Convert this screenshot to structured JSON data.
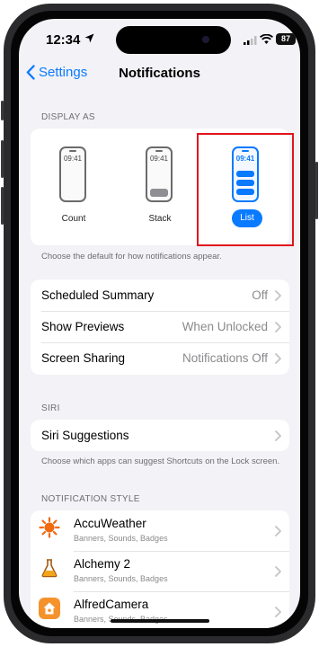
{
  "status_bar": {
    "time": "12:34",
    "battery": "87",
    "icons": [
      "location-icon",
      "signal-icon",
      "wifi-icon",
      "battery-icon"
    ]
  },
  "nav": {
    "back_label": "Settings",
    "title": "Notifications"
  },
  "display_as": {
    "header": "DISPLAY AS",
    "options": [
      {
        "label": "Count",
        "clock": "09:41",
        "selected": false
      },
      {
        "label": "Stack",
        "clock": "09:41",
        "selected": false
      },
      {
        "label": "List",
        "clock": "09:41",
        "selected": true
      }
    ],
    "caption": "Choose the default for how notifications appear."
  },
  "general_rows": [
    {
      "label": "Scheduled Summary",
      "value": "Off"
    },
    {
      "label": "Show Previews",
      "value": "When Unlocked"
    },
    {
      "label": "Screen Sharing",
      "value": "Notifications Off"
    }
  ],
  "siri": {
    "header": "SIRI",
    "row_label": "Siri Suggestions",
    "caption": "Choose which apps can suggest Shortcuts on the Lock screen."
  },
  "notification_style": {
    "header": "NOTIFICATION STYLE",
    "apps": [
      {
        "name": "AccuWeather",
        "detail": "Banners, Sounds, Badges",
        "icon": "sun-icon"
      },
      {
        "name": "Alchemy 2",
        "detail": "Banners, Sounds, Badges",
        "icon": "flask-icon"
      },
      {
        "name": "AlfredCamera",
        "detail": "Banners, Sounds, Badges",
        "icon": "house-icon"
      }
    ]
  },
  "colors": {
    "accent": "#0a7aff",
    "highlight": "#e0141c",
    "background": "#f2f2f7"
  }
}
